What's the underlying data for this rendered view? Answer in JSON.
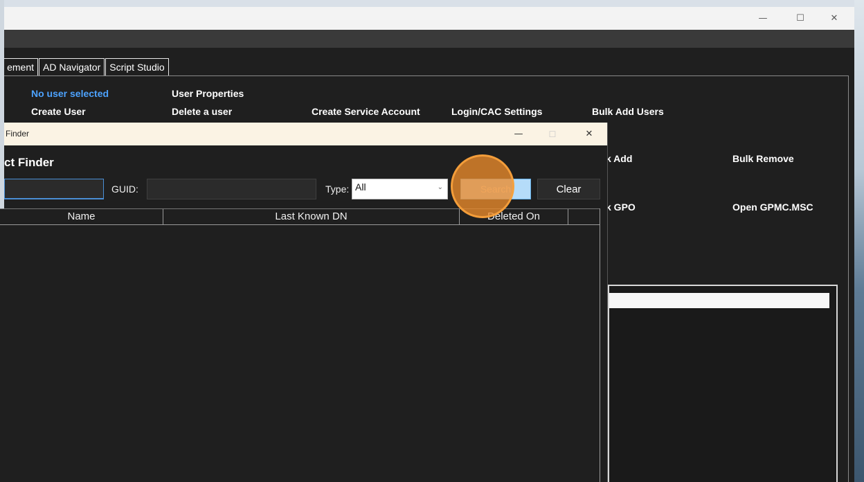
{
  "window": {
    "minimize_icon": "minimize-icon",
    "maximize_icon": "maximize-icon",
    "close_icon": "close-icon",
    "minimize_glyph": "—",
    "maximize_glyph": "☐",
    "close_glyph": "✕"
  },
  "tabs": [
    {
      "label": "ement"
    },
    {
      "label": "AD Navigator"
    },
    {
      "label": "Script Studio"
    }
  ],
  "user_panel": {
    "status": "No user selected",
    "create_user": "Create User",
    "user_properties": "User Properties",
    "delete_user": "Delete a user",
    "create_service_account": "Create Service Account",
    "login_cac_settings": "Login/CAC Settings",
    "bulk_add_users": "Bulk Add Users"
  },
  "group_panel": {
    "bulk_add": "k Add",
    "bulk_remove": "Bulk Remove",
    "bulk_gpo": "k GPO",
    "open_gpmc": "Open GPMC.MSC"
  },
  "finder": {
    "title": "Finder",
    "heading": "ct Finder",
    "guid_label": "GUID:",
    "type_label": "Type:",
    "type_value": "All",
    "search_label": "Search",
    "clear_label": "Clear",
    "columns": [
      "Name",
      "Last Known DN",
      "Deleted On"
    ]
  },
  "colors": {
    "accent": "#4da3ff",
    "search_button": "#b5dcf9",
    "click_highlight": "#ec8c2c"
  }
}
